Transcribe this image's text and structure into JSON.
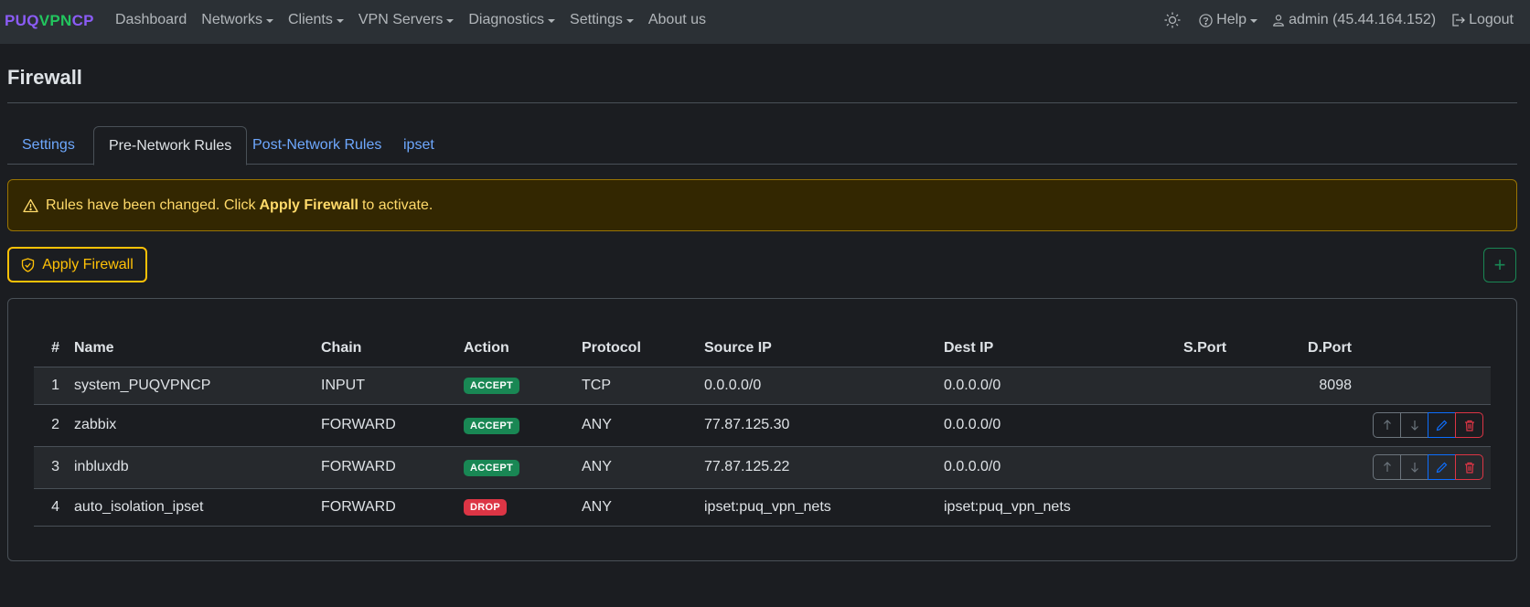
{
  "brand": {
    "part1": "PUQ",
    "part2": "VPN",
    "part3": "CP"
  },
  "nav": {
    "left": [
      {
        "label": "Dashboard",
        "dropdown": false
      },
      {
        "label": "Networks",
        "dropdown": true
      },
      {
        "label": "Clients",
        "dropdown": true
      },
      {
        "label": "VPN Servers",
        "dropdown": true
      },
      {
        "label": "Diagnostics",
        "dropdown": true
      },
      {
        "label": "Settings",
        "dropdown": true
      },
      {
        "label": "About us",
        "dropdown": false
      }
    ],
    "help": "Help",
    "user": "admin (45.44.164.152)",
    "logout": "Logout"
  },
  "page": {
    "title": "Firewall"
  },
  "tabs": [
    {
      "label": "Settings",
      "active": false
    },
    {
      "label": "Pre-Network Rules",
      "active": true
    },
    {
      "label": "Post-Network Rules",
      "active": false
    },
    {
      "label": "ipset",
      "active": false
    }
  ],
  "alert": {
    "prefix": "Rules have been changed. Click",
    "strong": "Apply Firewall",
    "suffix": "to activate."
  },
  "apply_button": "Apply Firewall",
  "add_button": "+",
  "table": {
    "headers": [
      "#",
      "Name",
      "Chain",
      "Action",
      "Protocol",
      "Source IP",
      "Dest IP",
      "S.Port",
      "D.Port"
    ],
    "rows": [
      {
        "num": "1",
        "name": "system_PUQVPNCP",
        "chain": "INPUT",
        "action": "ACCEPT",
        "protocol": "TCP",
        "source_ip": "0.0.0.0/0",
        "dest_ip": "0.0.0.0/0",
        "sport": "",
        "dport": "8098",
        "actions": false
      },
      {
        "num": "2",
        "name": "zabbix",
        "chain": "FORWARD",
        "action": "ACCEPT",
        "protocol": "ANY",
        "source_ip": "77.87.125.30",
        "dest_ip": "0.0.0.0/0",
        "sport": "",
        "dport": "",
        "actions": true
      },
      {
        "num": "3",
        "name": "inbluxdb",
        "chain": "FORWARD",
        "action": "ACCEPT",
        "protocol": "ANY",
        "source_ip": "77.87.125.22",
        "dest_ip": "0.0.0.0/0",
        "sport": "",
        "dport": "",
        "actions": true
      },
      {
        "num": "4",
        "name": "auto_isolation_ipset",
        "chain": "FORWARD",
        "action": "DROP",
        "protocol": "ANY",
        "source_ip": "ipset:puq_vpn_nets",
        "dest_ip": "ipset:puq_vpn_nets",
        "sport": "",
        "dport": "",
        "actions": false
      }
    ]
  },
  "colors": {
    "accept": "#198754",
    "drop": "#dc3545",
    "warning": "#ffc107",
    "link": "#6ea8fe"
  }
}
